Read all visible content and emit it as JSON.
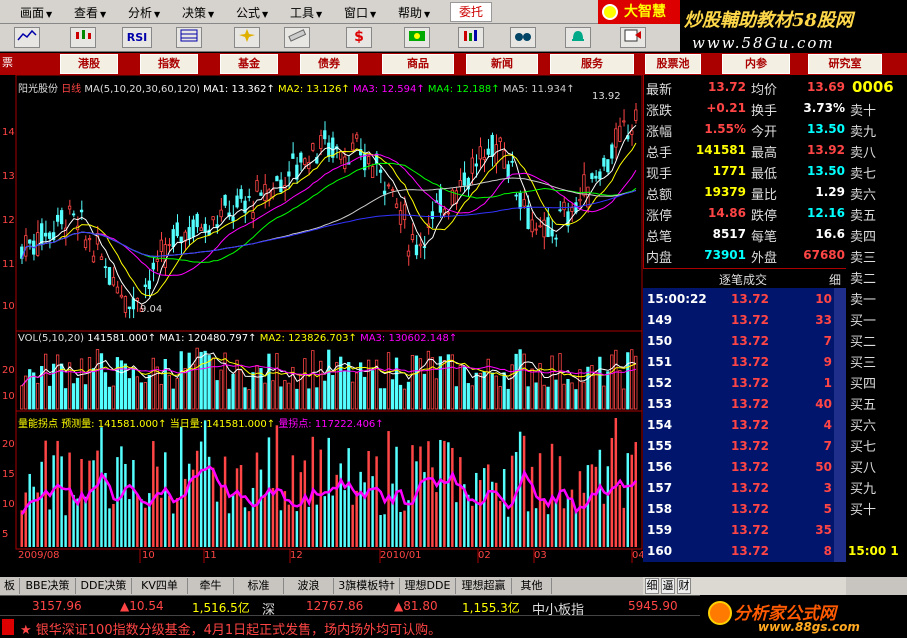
{
  "menu": [
    {
      "label": "画面"
    },
    {
      "label": "查看"
    },
    {
      "label": "分析"
    },
    {
      "label": "决策"
    },
    {
      "label": "公式"
    },
    {
      "label": "工具"
    },
    {
      "label": "窗口"
    },
    {
      "label": "帮助"
    }
  ],
  "menu_arrow": "▼",
  "trust_label": "委托",
  "brand_label": "大智慧",
  "watermark": {
    "line1": "炒股輔助教材58股网",
    "line2": "www.58Gu.com"
  },
  "toolbar": {
    "rsi": "RSI",
    "dollar": "$"
  },
  "nav_first": "票",
  "nav": [
    "港股",
    "指数",
    "基金",
    "债券",
    "商品",
    "新闻",
    "服务",
    "股票池",
    "内参",
    "研究室"
  ],
  "chart": {
    "stock_name": "阳光股份",
    "period": "日线",
    "ma_title": "MA(5,10,20,30,60,120)",
    "ma": [
      {
        "text": "MA1: 13.362↑",
        "color": "#ffffff"
      },
      {
        "text": "MA2: 13.126↑",
        "color": "#ffff00"
      },
      {
        "text": "MA3: 12.594↑",
        "color": "#ff00ff"
      },
      {
        "text": "MA4: 12.188↑",
        "color": "#00ff00"
      },
      {
        "text": "MA5: 11.934↑",
        "color": "#c0c0c0"
      }
    ],
    "high_mark": "13.92",
    "low_mark": "9.04",
    "vol_title": "VOL(5,10,20)",
    "vol": [
      {
        "text": "141581.000↑",
        "color": "#ffffff"
      },
      {
        "text": "MA1: 120480.797↑",
        "color": "#ffffff"
      },
      {
        "text": "MA2: 123826.703↑",
        "color": "#ffff00"
      },
      {
        "text": "MA3: 130602.148↑",
        "color": "#ff00ff"
      }
    ],
    "ind_title": "量能拐点",
    "ind": [
      {
        "text": "预测量: 141581.000↑",
        "color": "#ffff00"
      },
      {
        "text": "当日量: 141581.000↑",
        "color": "#ffff00"
      },
      {
        "text": "量拐点: 117222.406↑",
        "color": "#ff00ff"
      }
    ],
    "dates": [
      "2009/08",
      "10",
      "11",
      "12",
      "2010/01",
      "02",
      "03",
      "04"
    ],
    "y_price": [
      "14",
      "13",
      "12",
      "11",
      "10"
    ],
    "y_vol": [
      "20",
      "10"
    ],
    "y_ind": [
      "20",
      "15",
      "10",
      "5"
    ]
  },
  "code": "0006",
  "quote": [
    {
      "n1": "最新",
      "v1": "13.72",
      "c1": "#ff4545",
      "n2": "均价",
      "v2": "13.69",
      "c2": "#ff4545"
    },
    {
      "n1": "涨跌",
      "v1": "+0.21",
      "c1": "#ff4545",
      "n2": "换手",
      "v2": "3.73%",
      "c2": "#ffffff"
    },
    {
      "n1": "涨幅",
      "v1": "1.55%",
      "c1": "#ff4545",
      "n2": "今开",
      "v2": "13.50",
      "c2": "#00ffff"
    },
    {
      "n1": "总手",
      "v1": "141581",
      "c1": "#ffff00",
      "n2": "最高",
      "v2": "13.92",
      "c2": "#ff4545"
    },
    {
      "n1": "现手",
      "v1": "1771",
      "c1": "#ffff00",
      "n2": "最低",
      "v2": "13.50",
      "c2": "#00ffff"
    },
    {
      "n1": "总额",
      "v1": "19379",
      "c1": "#ffff00",
      "n2": "量比",
      "v2": "1.29",
      "c2": "#ffffff"
    },
    {
      "n1": "涨停",
      "v1": "14.86",
      "c1": "#ff4545",
      "n2": "跌停",
      "v2": "12.16",
      "c2": "#00ffff"
    },
    {
      "n1": "总笔",
      "v1": "8517",
      "c1": "#ffffff",
      "n2": "每笔",
      "v2": "16.6",
      "c2": "#ffffff"
    },
    {
      "n1": "内盘",
      "v1": "73901",
      "c1": "#00ffff",
      "n2": "外盘",
      "v2": "67680",
      "c2": "#ff4545"
    }
  ],
  "book": [
    "卖十",
    "卖九",
    "卖八",
    "卖七",
    "卖六",
    "卖五",
    "卖四",
    "卖三",
    "卖二",
    "卖一",
    "买一",
    "买二",
    "买三",
    "买四",
    "买五",
    "买六",
    "买七",
    "买八",
    "买九",
    "买十"
  ],
  "book_time": "15:00 1",
  "ticks_title": "逐笔成交",
  "ticks_tab": "细",
  "ticks": [
    {
      "t": "15:00:22",
      "p": "13.72",
      "v": "10"
    },
    {
      "t": "149",
      "p": "13.72",
      "v": "33"
    },
    {
      "t": "150",
      "p": "13.72",
      "v": "7"
    },
    {
      "t": "151",
      "p": "13.72",
      "v": "9"
    },
    {
      "t": "152",
      "p": "13.72",
      "v": "1"
    },
    {
      "t": "153",
      "p": "13.72",
      "v": "40"
    },
    {
      "t": "154",
      "p": "13.72",
      "v": "4"
    },
    {
      "t": "155",
      "p": "13.72",
      "v": "7"
    },
    {
      "t": "156",
      "p": "13.72",
      "v": "50"
    },
    {
      "t": "157",
      "p": "13.72",
      "v": "3"
    },
    {
      "t": "158",
      "p": "13.72",
      "v": "5"
    },
    {
      "t": "159",
      "p": "13.72",
      "v": "35"
    },
    {
      "t": "160",
      "p": "13.72",
      "v": "8"
    }
  ],
  "tabs": [
    "板",
    "BBE决策",
    "DDE决策",
    "KV四单",
    "牵牛",
    "标准",
    "波浪",
    "3旗模板特†",
    "理想DDE",
    "理想超赢",
    "其他"
  ],
  "mini_tabs": [
    "细",
    "逼",
    "财"
  ],
  "index": {
    "sh_val": "3157.96",
    "sh_chg": "▲10.54",
    "sh_amt": "1,516.5亿",
    "sh_name": "深",
    "sz_val": "12767.86",
    "sz_chg": "▲81.80",
    "sz_amt": "1,155.3亿",
    "sz_name": "中小板指",
    "sme_val": "5945.90"
  },
  "ticker": "★ 银华深证100指数分级基金，4月1日起正式发售，场内场外均可认购。",
  "logo2": {
    "main": "分析家公式网",
    "url": "www.88gs.com"
  }
}
